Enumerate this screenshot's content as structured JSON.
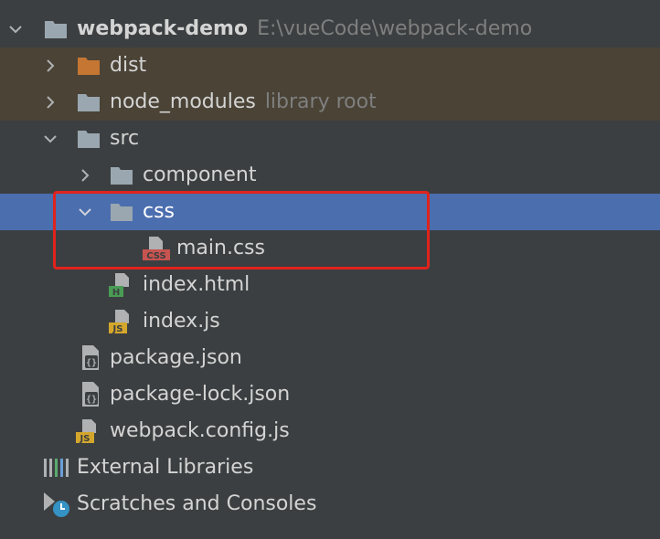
{
  "project": {
    "name": "webpack-demo",
    "path": "E:\\vueCode\\webpack-demo"
  },
  "nodes": {
    "dist": "dist",
    "node_modules": "node_modules",
    "node_modules_hint": "library root",
    "src": "src",
    "component": "component",
    "css": "css",
    "main_css": "main.css",
    "index_html": "index.html",
    "index_js": "index.js",
    "package_json": "package.json",
    "package_lock_json": "package-lock.json",
    "webpack_config_js": "webpack.config.js",
    "external_libraries": "External Libraries",
    "scratches": "Scratches and Consoles"
  },
  "badges": {
    "css": "CSS",
    "html": "H",
    "js": "JS",
    "json": "{}"
  },
  "colors": {
    "background": "#3c3f41",
    "excluded_row": "#4a4336",
    "selected_row": "#4b6eaf",
    "folder": "#9aa7b0",
    "excluded_folder": "#c57633",
    "highlight_box": "#e0231c",
    "css_badge": "#c75450",
    "html_badge": "#499c54",
    "js_badge": "#d4a72c"
  },
  "icons": {
    "expand": "chevron-down-icon",
    "collapse": "chevron-right-icon",
    "folder": "folder-icon",
    "file": "file-icon",
    "libraries": "library-icon",
    "scratches": "scratches-icon"
  }
}
